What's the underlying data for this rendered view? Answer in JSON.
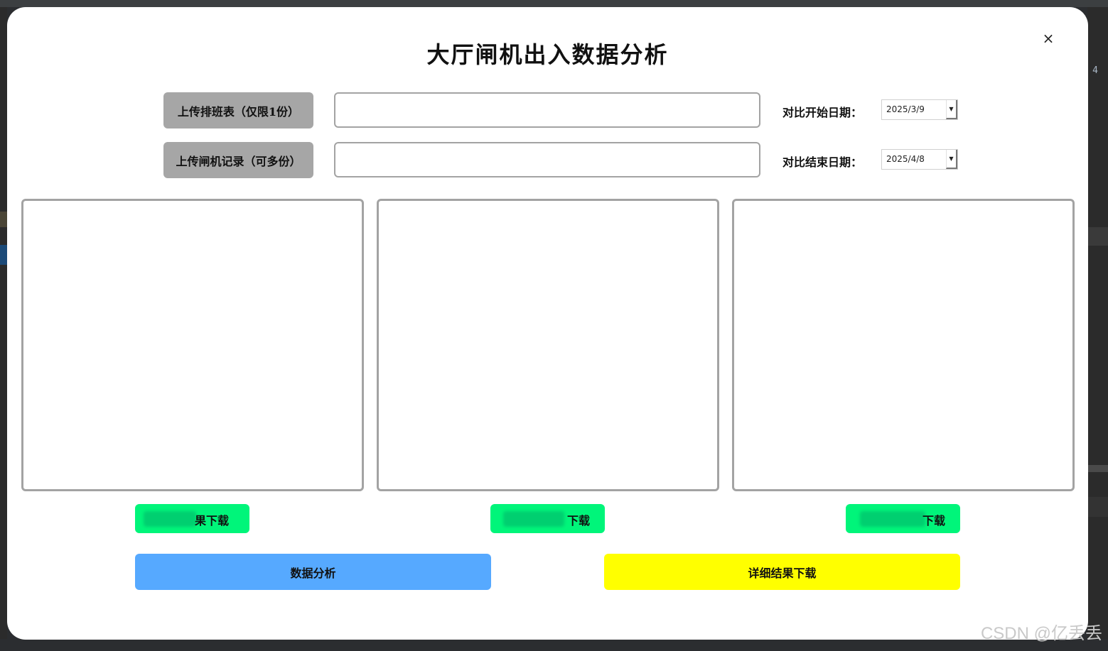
{
  "dialog": {
    "title": "大厅闸机出入数据分析",
    "close_glyph": "×"
  },
  "upload": {
    "schedule_label": "上传排班表（仅限1份）",
    "gate_label": "上传闸机记录（可多份）"
  },
  "dates": {
    "start_label": "对比开始日期：",
    "start_value": "2025/3/9",
    "end_label": "对比结束日期：",
    "end_value": "2025/4/8",
    "drop_glyph": "▼"
  },
  "downloads": {
    "btn1_visible": "果下载",
    "btn2_visible": "下载",
    "btn3_visible": "下载"
  },
  "actions": {
    "analyze_label": "数据分析",
    "detail_label": "详细结果下载"
  },
  "colors": {
    "upload_button": "#a6a6a6",
    "download_button": "#00f57a",
    "analyze_button": "#56a9ff",
    "detail_button": "#ffff00"
  },
  "ide": {
    "line_number": "4"
  },
  "watermark": "CSDN @亿丢丢"
}
